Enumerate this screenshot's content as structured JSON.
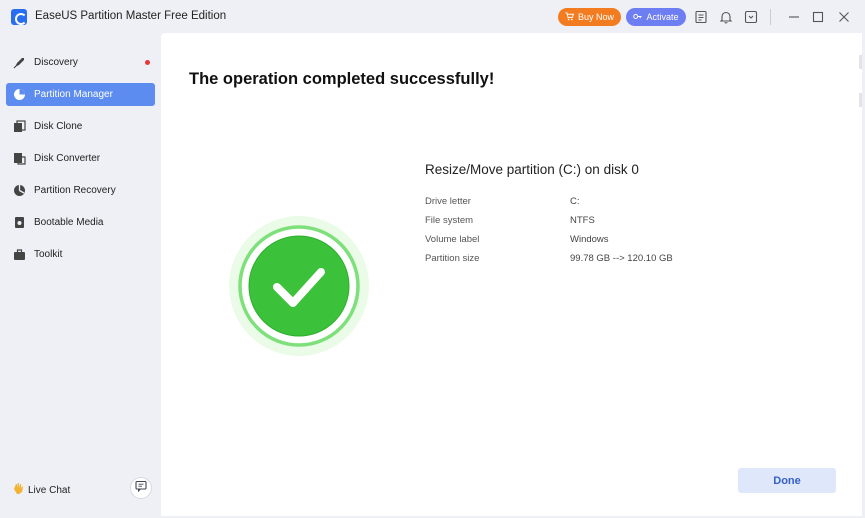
{
  "app": {
    "title": "EaseUS Partition Master Free Edition"
  },
  "header": {
    "buy_now": "Buy Now",
    "activate": "Activate",
    "icons": [
      "feedback-icon",
      "bell-icon",
      "download-box-icon",
      "minimize-icon",
      "maximize-icon",
      "close-icon"
    ]
  },
  "sidebar": {
    "items": [
      {
        "label": "Discovery",
        "icon": "rocket-icon",
        "active": false,
        "notification": true
      },
      {
        "label": "Partition Manager",
        "icon": "pie-chart-icon",
        "active": true
      },
      {
        "label": "Disk Clone",
        "icon": "clone-icon",
        "active": false
      },
      {
        "label": "Disk Converter",
        "icon": "converter-icon",
        "active": false
      },
      {
        "label": "Partition Recovery",
        "icon": "recovery-icon",
        "active": false
      },
      {
        "label": "Bootable Media",
        "icon": "media-icon",
        "active": false
      },
      {
        "label": "Toolkit",
        "icon": "toolbox-icon",
        "active": false
      }
    ],
    "live_chat": "Live Chat"
  },
  "main": {
    "headline": "The operation completed successfully!",
    "operation_title": "Resize/Move partition (C:) on disk 0",
    "details": [
      {
        "label": "Drive letter",
        "value": "C:"
      },
      {
        "label": "File system",
        "value": "NTFS"
      },
      {
        "label": "Volume label",
        "value": "Windows"
      },
      {
        "label": "Partition size",
        "value": "99.78 GB --> 120.10 GB"
      }
    ],
    "done_button": "Done"
  },
  "colors": {
    "accent": "#5d8cf0",
    "buy_now": "#f47c20",
    "activate": "#6d7df2",
    "success": "#3cc13b",
    "notification_dot": "#e5383b"
  }
}
